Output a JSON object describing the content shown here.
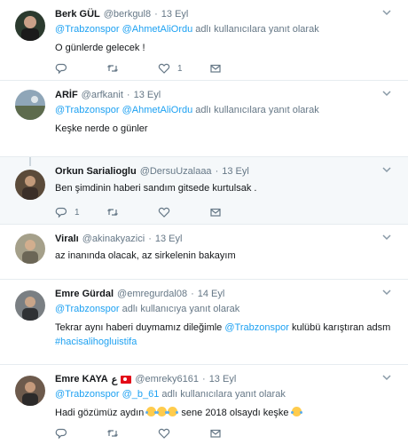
{
  "tweets": [
    {
      "name": "Berk GÜL",
      "handle": "@berkgul8",
      "sep": "·",
      "time": "13 Eyl",
      "reply_to": [
        "@Trabzonspor",
        "@AhmetAliOrdu"
      ],
      "reply_suffix": "adlı kullanıcılara yanıt olarak",
      "text": "O günlerde gelecek !",
      "retweet_count": "",
      "like_count": "1",
      "reply_count": ""
    },
    {
      "name": "ARİF",
      "handle": "@arfkanit",
      "sep": "·",
      "time": "13 Eyl",
      "reply_to": [
        "@Trabzonspor",
        "@AhmetAliOrdu"
      ],
      "reply_suffix": "adlı kullanıcılara yanıt olarak",
      "text": "Keşke nerde o günler"
    },
    {
      "name": "Orkun Sarialioglu",
      "handle": "@DersuUzalaaa",
      "sep": "·",
      "time": "13 Eyl",
      "text": "Ben şimdinin haberi sandım gitsede kurtulsak .",
      "reply_count": "1"
    },
    {
      "name": "Viralı",
      "handle": "@akinakyazici",
      "sep": "·",
      "time": "13 Eyl",
      "text": "az inanında olacak, az sirkelenin bakayım"
    },
    {
      "name": "Emre Gürdal",
      "handle": "@emregurdal08",
      "sep": "·",
      "time": "14 Eyl",
      "reply_to": [
        "@Trabzonspor"
      ],
      "reply_suffix": "adlı kullanıcıya yanıt olarak",
      "text_a": "Tekrar aynı haberi duymamız dileğimle",
      "text_mention": "@Trabzonspor",
      "text_b": "kulübü karıştıran adsm",
      "hashtag": "#hacisalihogluistifa"
    },
    {
      "name": "Emre KAYA",
      "name_suffix": "ع",
      "handle": "@emreky6161",
      "sep": "·",
      "time": "13 Eyl",
      "reply_to": [
        "@Trabzonspor",
        "@_b_61"
      ],
      "reply_suffix": "adlı kullanıcılara yanıt olarak",
      "text_a": "Hadi gözümüz aydın",
      "text_b": "sene 2018 olsaydı keşke"
    }
  ],
  "icons": {
    "reply": "reply-icon",
    "retweet": "retweet-icon",
    "like": "heart-icon",
    "dm": "envelope-icon",
    "more": "chevron-down-icon",
    "flag": "turkey-flag-icon",
    "emoji": "tears-of-joy-emoji"
  },
  "colors": {
    "link": "#1da1f2",
    "muted": "#657786",
    "text": "#14171a",
    "reply_bg": "#f5f8fa"
  }
}
